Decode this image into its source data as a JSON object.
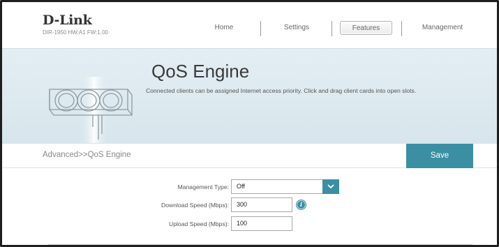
{
  "header": {
    "logo": "D-Link",
    "model_info": "DIR-1950 HW:A1 FW:1.00"
  },
  "nav": {
    "items": [
      {
        "label": "Home"
      },
      {
        "label": "Settings"
      },
      {
        "label": "Features",
        "active": true
      },
      {
        "label": "Management"
      }
    ]
  },
  "banner": {
    "title": "QoS Engine",
    "description": "Connected clients can be assigned Internet access priority. Click and drag client cards into open slots."
  },
  "breadcrumb": "Advanced>>QoS Engine",
  "toolbar": {
    "save_label": "Save"
  },
  "form": {
    "management_type": {
      "label": "Management Type:",
      "value": "Off"
    },
    "download_speed": {
      "label": "Download Speed (Mbps):",
      "value": "300"
    },
    "upload_speed": {
      "label": "Upload Speed (Mbps):",
      "value": "100"
    }
  },
  "colors": {
    "accent": "#3b8fa3",
    "banner_bg": "#dce9ef",
    "text": "#555555"
  },
  "icons": [
    "chevron-down-icon",
    "info-icon",
    "router-device-illustration"
  ]
}
